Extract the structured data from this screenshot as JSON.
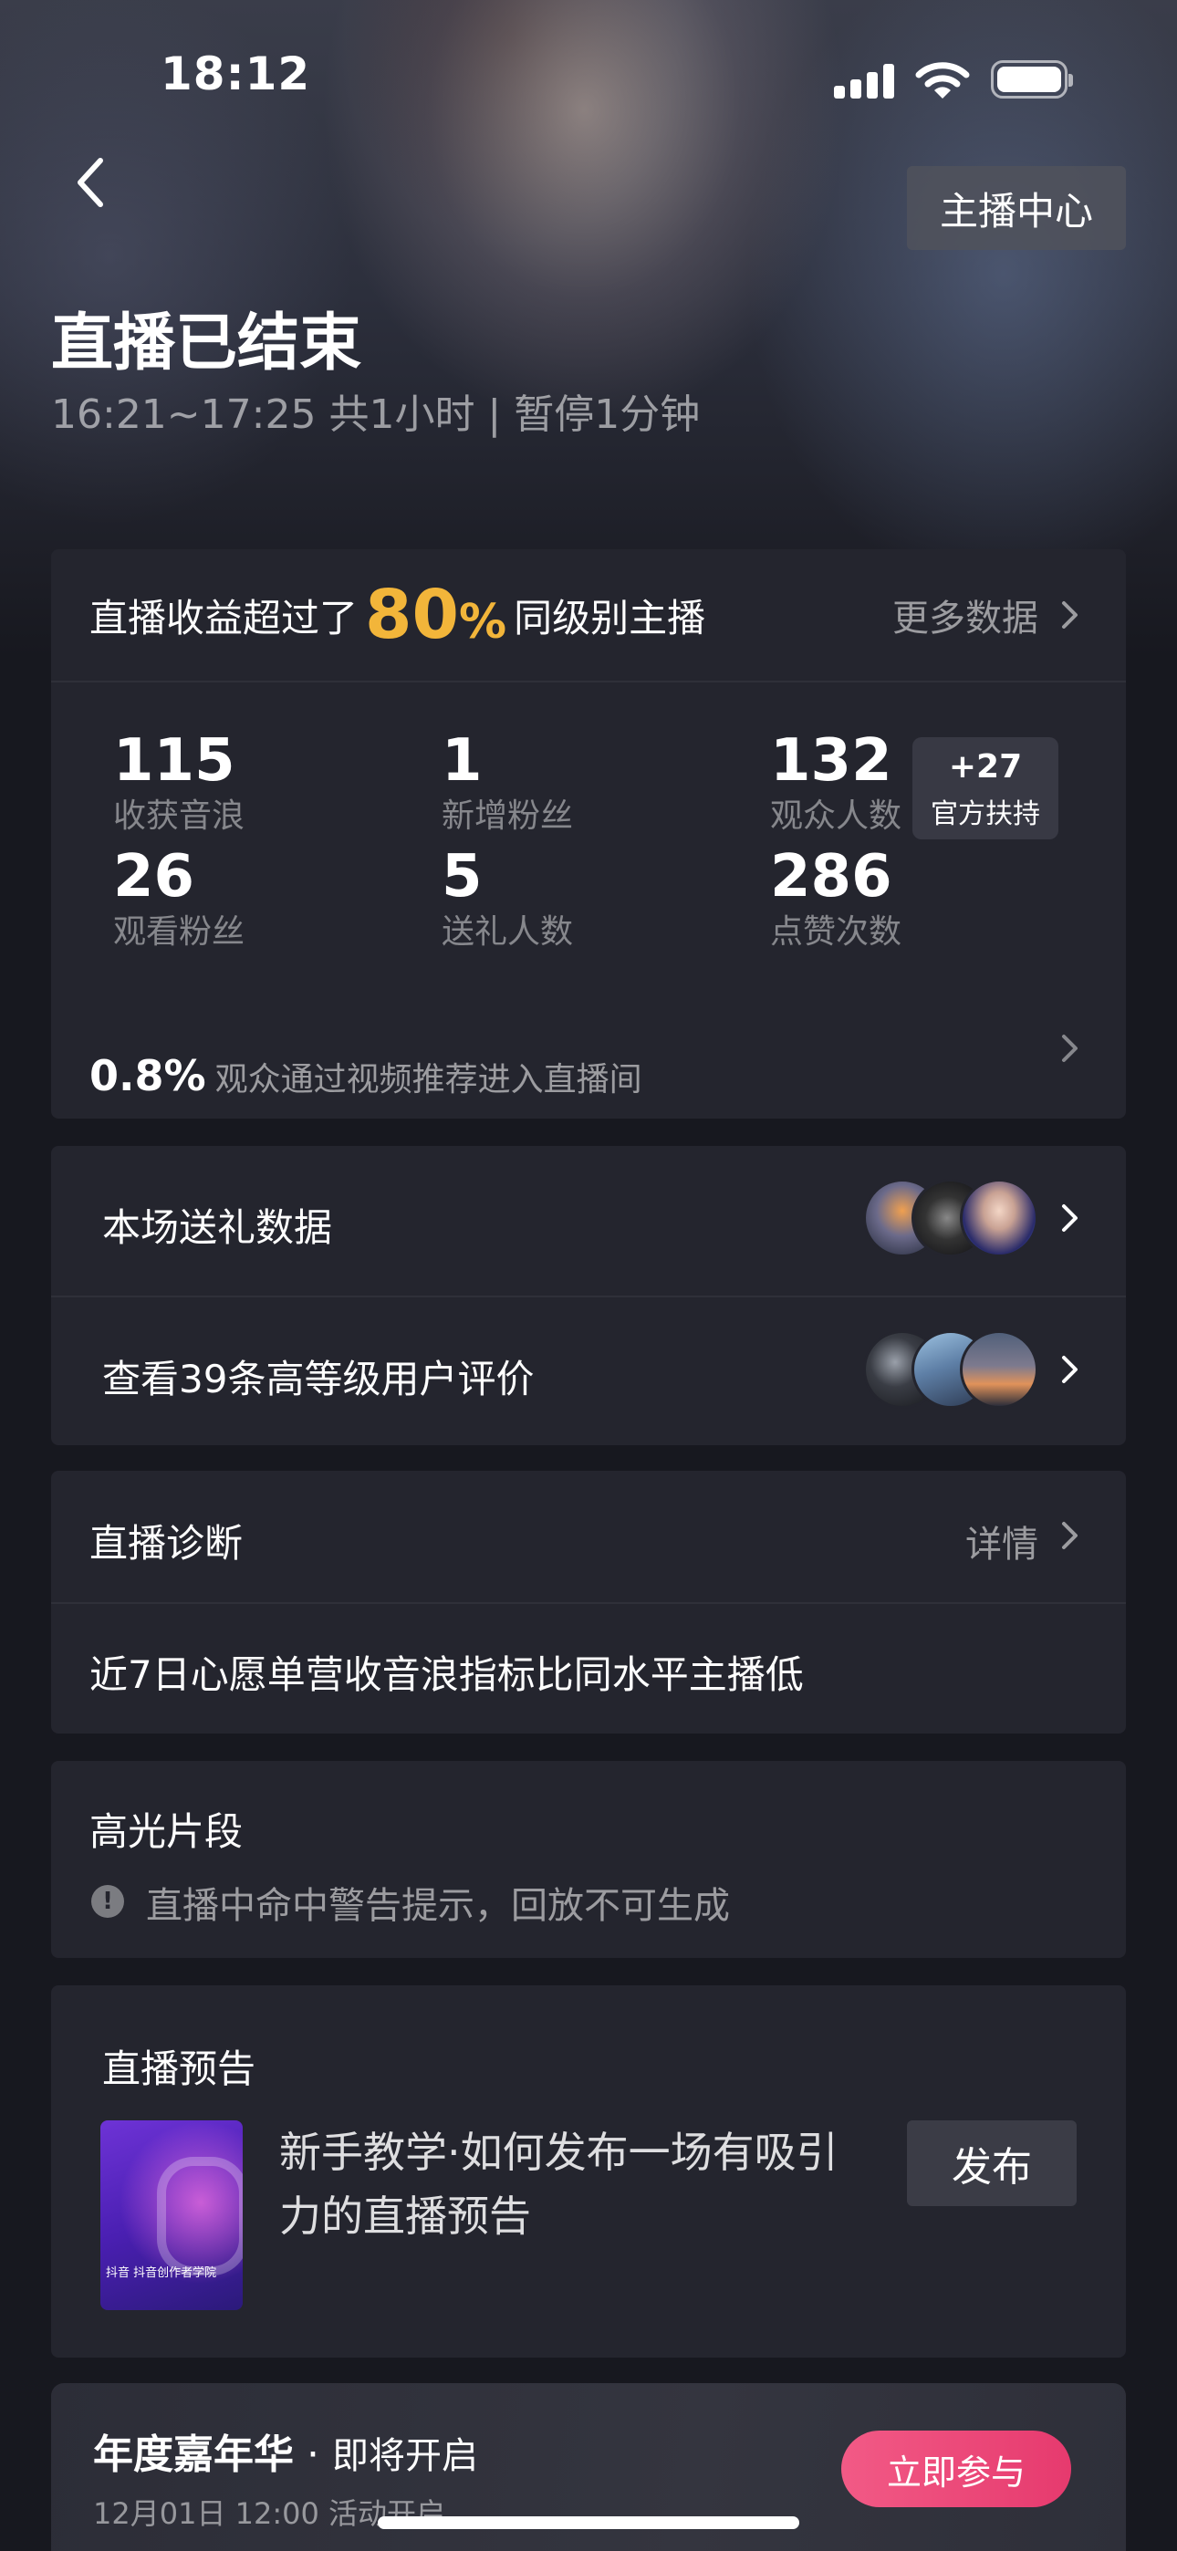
{
  "status_bar": {
    "time": "18:12"
  },
  "header": {
    "center_button": "主播中心",
    "title": "直播已结束",
    "subtitle": "16:21~17:25  共1小时 | 暂停1分钟"
  },
  "summary": {
    "rank_prefix": "直播收益超过了",
    "rank_value": "80",
    "rank_unit": "%",
    "rank_suffix": "同级别主播",
    "more_data": "更多数据",
    "stats": [
      {
        "value": "115",
        "label": "收获音浪"
      },
      {
        "value": "1",
        "label": "新增粉丝"
      },
      {
        "value": "132",
        "label": "观众人数"
      },
      {
        "value": "26",
        "label": "观看粉丝"
      },
      {
        "value": "5",
        "label": "送礼人数"
      },
      {
        "value": "286",
        "label": "点赞次数"
      }
    ],
    "boost": {
      "value": "+27",
      "label": "官方扶持"
    },
    "recommend_pct": "0.8%",
    "recommend_text": "观众通过视频推荐进入直播间"
  },
  "gifts": {
    "gift_row": "本场送礼数据",
    "review_row": "查看39条高等级用户评价"
  },
  "diagnosis": {
    "title": "直播诊断",
    "detail": "详情",
    "content": "近7日心愿单营收音浪指标比同水平主播低"
  },
  "highlights": {
    "title": "高光片段",
    "warning": "直播中命中警告提示，回放不可生成"
  },
  "preview": {
    "title": "直播预告",
    "thumb_caption": "抖音 抖音创作者学院",
    "text": "新手教学·如何发布一场有吸引力的直播预告",
    "publish_button": "发布"
  },
  "promo": {
    "title": "年度嘉年华",
    "dot": "·",
    "soon": "即将开启",
    "subtitle": "12月01日 12:00 活动开启",
    "join_button": "立即参与"
  }
}
